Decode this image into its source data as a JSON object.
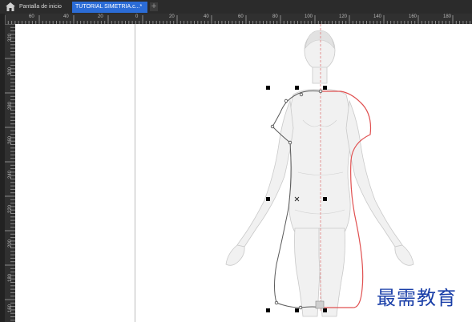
{
  "tabs": {
    "home_label": "Pantalla de inicio",
    "active_label": "TUTORIAL SIMETRIA.c...*",
    "add_label": "+"
  },
  "ruler": {
    "horizontal": [
      "60",
      "40",
      "20",
      "0",
      "20",
      "40",
      "60",
      "80",
      "100",
      "120",
      "140",
      "160",
      "180"
    ],
    "vertical": [
      "320",
      "300",
      "280",
      "260",
      "240",
      "220",
      "200",
      "180",
      "160"
    ]
  },
  "watermark": "最需教育",
  "colors": {
    "accent_tab": "#2b6cd6",
    "mirror_path": "#e05050",
    "selected_path": "#5a5a5a",
    "watermark": "#1a3fa8"
  }
}
